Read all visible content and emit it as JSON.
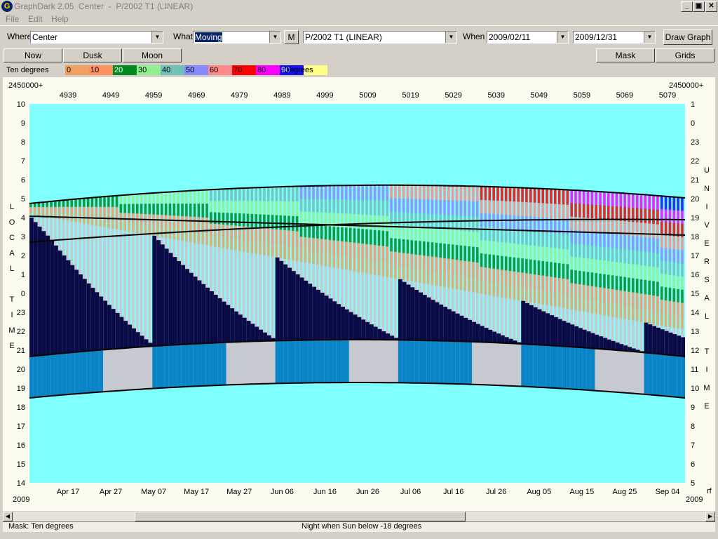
{
  "window": {
    "title": "GraphDark 2.05  Center  -  P/2002 T1 (LINEAR)",
    "minimize": "_",
    "restore": "▣",
    "close": "✕"
  },
  "menu": {
    "file": "File",
    "edit": "Edit",
    "help": "Help"
  },
  "toolbar": {
    "where_label": "Where",
    "where_value": "Center",
    "what_label": "What",
    "what_value": "Moving",
    "m_button": "M",
    "object_value": "P/2002 T1 (LINEAR)",
    "when_label": "When",
    "start_date": "2009/02/11",
    "end_date": "2009/12/31",
    "draw_graph": "Draw Graph",
    "now": "Now",
    "dusk": "Dusk",
    "moon": "Moon",
    "mask": "Mask",
    "grids": "Grids"
  },
  "legend": {
    "mask_name": "Ten degrees",
    "units": "Degrees",
    "entries": [
      {
        "label": "0",
        "color": "#f0a060"
      },
      {
        "label": "10",
        "color": "#ff9060"
      },
      {
        "label": "20",
        "color": "#008a22"
      },
      {
        "label": "30",
        "color": "#90f090"
      },
      {
        "label": "40",
        "color": "#70c0b8"
      },
      {
        "label": "50",
        "color": "#8888ff"
      },
      {
        "label": "60",
        "color": "#ff8888"
      },
      {
        "label": "70",
        "color": "#ff0000"
      },
      {
        "label": "80",
        "color": "#ff00ff"
      },
      {
        "label": "90",
        "color": "#1010f0"
      },
      {
        "label": "",
        "color": "#ffff88"
      }
    ]
  },
  "chart_data": {
    "type": "heatmap",
    "jd_prefix_left": "2450000+",
    "jd_prefix_right": "2450000+",
    "jd_ticks": [
      "4939",
      "4949",
      "4959",
      "4969",
      "4979",
      "4989",
      "4999",
      "5009",
      "5019",
      "5029",
      "5039",
      "5049",
      "5059",
      "5069",
      "5079"
    ],
    "date_ticks": [
      "Apr 17",
      "Apr 27",
      "May 07",
      "May 17",
      "May 27",
      "Jun 06",
      "Jun 16",
      "Jun 26",
      "Jul 06",
      "Jul 16",
      "Jul 26",
      "Aug 05",
      "Aug 15",
      "Aug 25",
      "Sep 04"
    ],
    "year_left": "2009",
    "year_right": "2009",
    "corner_right_bottom": "rf",
    "local_time_ticks": [
      "10",
      "9",
      "8",
      "7",
      "6",
      "5",
      "4",
      "3",
      "2",
      "1",
      "0",
      "23",
      "22",
      "21",
      "20",
      "19",
      "18",
      "17",
      "16",
      "15",
      "14"
    ],
    "universal_time_ticks": [
      "1",
      "0",
      "23",
      "22",
      "21",
      "20",
      "19",
      "18",
      "17",
      "16",
      "15",
      "14",
      "13",
      "12",
      "11",
      "10",
      "9",
      "8",
      "7",
      "6",
      "5"
    ],
    "left_axis_label": "LOCAL TIME",
    "right_axis_label": "UNIVERSAL TIME",
    "colors": {
      "background": "#80ffff",
      "night": "#0a0a46",
      "twilight": "#0a84c6",
      "moonlit": "#c8c8d0"
    }
  },
  "status": {
    "mask_label": "Mask:  Ten degrees",
    "night_label": "Night when Sun below -18 degrees"
  }
}
